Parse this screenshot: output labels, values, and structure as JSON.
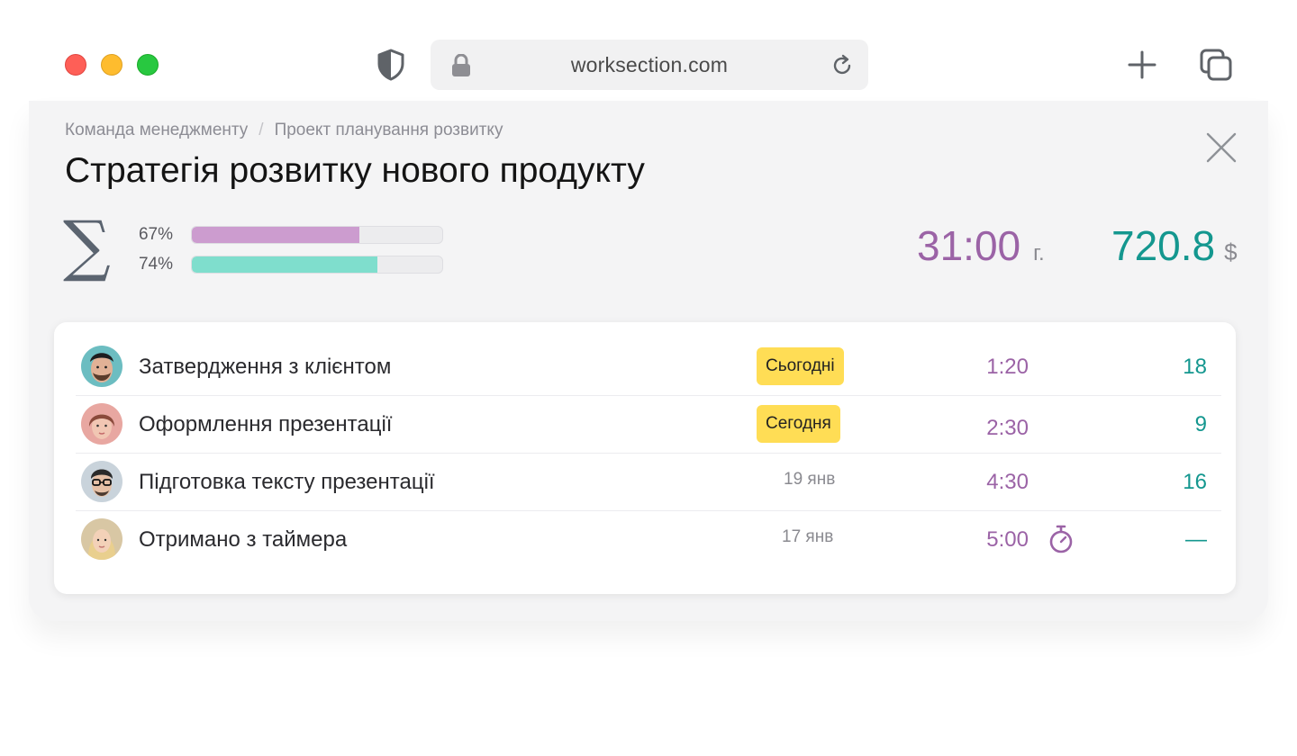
{
  "browser": {
    "url": "worksection.com",
    "colors": {
      "close": "#fe5f57",
      "minimize": "#febc2e",
      "maximize": "#28c840"
    }
  },
  "panel": {
    "breadcrumb": [
      "Команда менеджменту",
      "Проект планування розвитку"
    ],
    "breadcrumb_separator": "/",
    "title": "Стратегія розвитку нового продукту",
    "summary": {
      "sigma_symbol": "∑",
      "progress": [
        {
          "label": "67%",
          "value": 0.67,
          "color": "#cc9ccf"
        },
        {
          "label": "74%",
          "value": 0.74,
          "color": "#7fdecd"
        }
      ],
      "time_total": "31:00",
      "time_unit": "г.",
      "money_total": "720.8",
      "money_unit": "$"
    },
    "tasks": [
      {
        "name": "Затвердження з клієнтом",
        "date": "Сьогодні",
        "date_highlight": true,
        "time": "1:20",
        "money": "18",
        "timer": false,
        "avatar": "avatar-bearded-man"
      },
      {
        "name": "Оформлення презентації",
        "date": "Сегодня",
        "date_highlight": true,
        "time": "2:30",
        "money": "9",
        "timer": false,
        "avatar": "avatar-woman-red"
      },
      {
        "name": "Підготовка тексту презентації",
        "date": "19 янв",
        "date_highlight": false,
        "time": "4:30",
        "money": "16",
        "timer": false,
        "avatar": "avatar-man-glasses"
      },
      {
        "name": "Отримано з таймера",
        "date": "17 янв",
        "date_highlight": false,
        "time": "5:00",
        "money": "—",
        "timer": true,
        "avatar": "avatar-blonde-woman"
      }
    ],
    "colors": {
      "time": "#9b63a6",
      "money": "#14978f",
      "badge": "#ffdd55"
    }
  }
}
